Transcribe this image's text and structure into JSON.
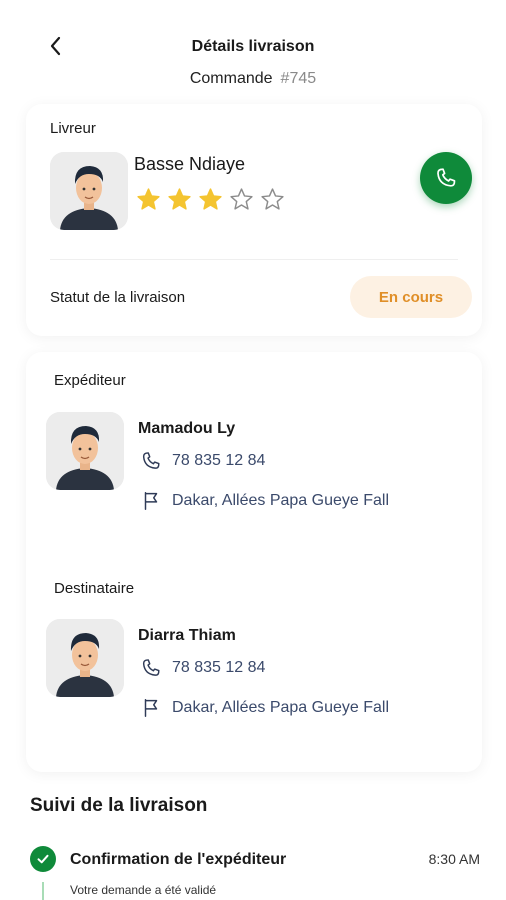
{
  "header": {
    "title": "Détails livraison",
    "order_label": "Commande",
    "order_number": "#745"
  },
  "driver": {
    "section_label": "Livreur",
    "name": "Basse Ndiaye",
    "rating": 3,
    "rating_max": 5,
    "status_label": "Statut de la livraison",
    "status_value": "En cours"
  },
  "sender": {
    "section_label": "Expéditeur",
    "name": "Mamadou Ly",
    "phone": "78 835 12 84",
    "address": "Dakar, Allées Papa Gueye Fall"
  },
  "recipient": {
    "section_label": "Destinataire",
    "name": "Diarra Thiam",
    "phone": "78 835 12 84",
    "address": "Dakar, Allées Papa Gueye Fall"
  },
  "tracking": {
    "title": "Suivi de la livraison",
    "steps": [
      {
        "title": "Confirmation de l'expéditeur",
        "time": "8:30 AM",
        "subtitle": "Votre demande a été validé"
      }
    ]
  },
  "colors": {
    "accent_green": "#0f8a3a",
    "status_orange": "#e08f28",
    "status_bg": "#fdf1e3",
    "star_filled": "#f4c430",
    "text_link": "#3b4a6b"
  },
  "icons": {
    "back": "chevron-left-icon",
    "call": "phone-icon",
    "phone": "phone-outline-icon",
    "address": "flag-icon",
    "check": "check-circle-icon",
    "star": "star-icon"
  }
}
